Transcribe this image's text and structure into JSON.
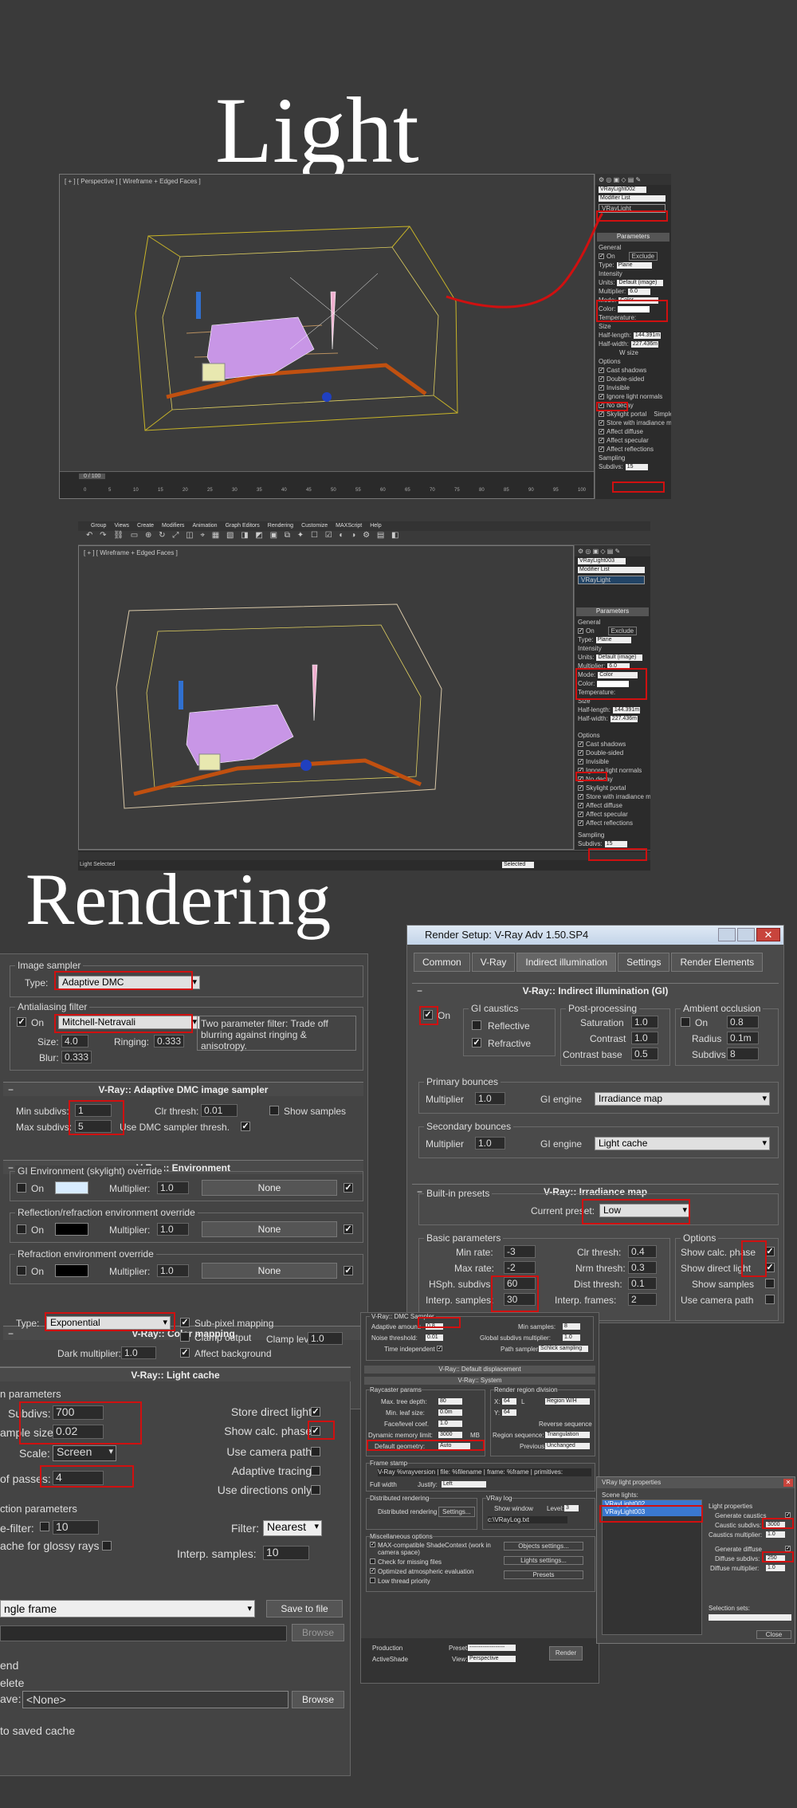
{
  "titles": {
    "light": "Light",
    "rendering": "Rendering"
  },
  "viewport1": {
    "label": "[ + ] [ Perspective ] [ Wireframe + Edged Faces ]",
    "object_name": "VRayLight002",
    "modifier_list": "Modifier List",
    "stack_item": "VRayLight",
    "timeline": "0 / 100",
    "ticks": [
      "0",
      "5",
      "10",
      "15",
      "20",
      "25",
      "30",
      "35",
      "40",
      "45",
      "50",
      "55",
      "60",
      "65",
      "70",
      "75",
      "80",
      "85",
      "90",
      "95",
      "100"
    ],
    "params": {
      "header": "Parameters",
      "general": "General",
      "on": "On",
      "exclude": "Exclude",
      "type_label": "Type:",
      "type_value": "Plane",
      "intensity": "Intensity",
      "units_label": "Units:",
      "units_value": "Default (image)",
      "multiplier_label": "Multiplier:",
      "multiplier_value": "6.0",
      "mode_label": "Mode:",
      "mode_value": "Color",
      "color_label": "Color:",
      "temp_label": "Temperature:",
      "size": "Size",
      "half_length_label": "Half-length:",
      "half_length_value": "144.391m",
      "half_width_label": "Half-width:",
      "half_width_value": "227.436m",
      "wsize_label": "W size",
      "options": "Options",
      "opt_list": [
        "Cast shadows",
        "Double-sided",
        "Invisible",
        "Ignore light normals",
        "No decay",
        "Skylight portal",
        "Store with irradiance map",
        "Affect diffuse",
        "Affect specular",
        "Affect reflections"
      ],
      "simple": "Simple",
      "sampling": "Sampling",
      "subdivs_label": "Subdivs:",
      "subdivs_value": "15"
    }
  },
  "viewport2": {
    "menu": [
      "Group",
      "Views",
      "Create",
      "Modifiers",
      "Animation",
      "Graph Editors",
      "Rendering",
      "Customize",
      "MAXScript",
      "Help"
    ],
    "label": "[ + ] [ Wireframe + Edged Faces ]",
    "object_name": "VRayLight003",
    "modifier_list": "Modifier List",
    "stack_item": "VRayLight",
    "status_left": "Light Selected",
    "selected_field": "Selected",
    "params": {
      "header": "Parameters",
      "general": "General",
      "on": "On",
      "exclude": "Exclude",
      "type_label": "Type:",
      "type_value": "Plane",
      "intensity": "Intensity",
      "units_label": "Units:",
      "units_value": "Default (image)",
      "multiplier_label": "Multiplier:",
      "multiplier_value": "6.0",
      "mode_label": "Mode:",
      "mode_value": "Color",
      "color_label": "Color:",
      "temp_label": "Temperature:",
      "size": "Size",
      "half_length_label": "Half-length:",
      "half_length_value": "144.391m",
      "half_width_label": "Half-width:",
      "half_width_value": "227.436m",
      "options": "Options",
      "opt_list": [
        "Cast shadows",
        "Double-sided",
        "Invisible",
        "Ignore light normals",
        "No decay",
        "Skylight portal",
        "Store with irradiance map",
        "Affect diffuse",
        "Affect specular",
        "Affect reflections"
      ],
      "sampling": "Sampling",
      "subdivs_label": "Subdivs:",
      "subdivs_value": "15"
    }
  },
  "left_panel": {
    "image_sampler": {
      "group": "Image sampler",
      "type_label": "Type:",
      "type_value": "Adaptive DMC"
    },
    "aa_filter": {
      "group": "Antialiasing filter",
      "on_label": "On",
      "filter_value": "Mitchell-Netravali",
      "desc": "Two parameter filter: Trade off blurring against ringing & anisotropy.",
      "size_label": "Size:",
      "size_value": "4.0",
      "ringing_label": "Ringing:",
      "ringing_value": "0.333",
      "blur_label": "Blur:",
      "blur_value": "0.333"
    },
    "adaptive_dmc": {
      "title": "V-Ray:: Adaptive DMC image sampler",
      "min_label": "Min subdivs:",
      "min_value": "1",
      "max_label": "Max subdivs:",
      "max_value": "5",
      "clr_label": "Clr thresh:",
      "clr_value": "0.01",
      "show_samples": "Show samples",
      "use_dmc": "Use DMC sampler thresh."
    },
    "environment": {
      "title": "V-Ray:: Environment",
      "gi_group": "GI Environment (skylight) override",
      "refl_group": "Reflection/refraction environment override",
      "refr_group": "Refraction environment override",
      "on": "On",
      "mult_label": "Multiplier:",
      "mult_value": "1.0",
      "none": "None"
    },
    "color_mapping": {
      "title": "V-Ray:: Color mapping",
      "type_label": "Type:",
      "type_value": "Exponential",
      "subpixel": "Sub-pixel mapping",
      "clamp": "Clamp output",
      "clamp_level_label": "Clamp level:",
      "clamp_level_value": "1.0",
      "dark_label": "Dark multiplier:",
      "dark_value": "1.0",
      "affect_bg": "Affect background"
    }
  },
  "light_cache": {
    "title": "V-Ray:: Light cache",
    "calc_params": "n parameters",
    "subdivs_label": "Subdivs:",
    "subdivs_value": "700",
    "sample_size_label": "ample size:",
    "sample_size_value": "0.02",
    "scale_label": "Scale:",
    "scale_value": "Screen",
    "passes_label": "of passes:",
    "passes_value": "4",
    "store_direct": "Store direct light",
    "show_calc": "Show calc. phase",
    "use_camera": "Use camera path",
    "adaptive": "Adaptive tracing",
    "directions": "Use directions only",
    "recon_params": "ction parameters",
    "prefilter_label": "e-filter:",
    "prefilter_value": "10",
    "glossy": "ache for glossy rays",
    "filter_label": "Filter:",
    "filter_value": "Nearest",
    "interp_label": "Interp. samples:",
    "interp_value": "10",
    "mode_value": "ngle frame",
    "save_btn": "Save to file",
    "browse1": "Browse",
    "on_end": "end",
    "delete": "elete",
    "save_label": "ave:",
    "save_value": "<None>",
    "browse2": "Browse",
    "saved_cache": "to saved cache"
  },
  "render_setup": {
    "title": "Render Setup: V-Ray Adv 1.50.SP4",
    "tabs": [
      "Common",
      "V-Ray",
      "Indirect illumination",
      "Settings",
      "Render Elements"
    ],
    "gi_title": "V-Ray:: Indirect illumination (GI)",
    "on": "On",
    "gi_caustics": "GI caustics",
    "reflective": "Reflective",
    "refractive": "Refractive",
    "post": "Post-processing",
    "saturation_label": "Saturation",
    "saturation_value": "1.0",
    "contrast_label": "Contrast",
    "contrast_value": "1.0",
    "contrast_base_label": "Contrast base",
    "contrast_base_value": "0.5",
    "ao": "Ambient occlusion",
    "ao_on": "On",
    "ao_on_value": "0.8",
    "radius_label": "Radius",
    "radius_value": "0.1m",
    "ao_subdivs_label": "Subdivs",
    "ao_subdivs_value": "8",
    "primary": "Primary bounces",
    "multiplier_label": "Multiplier",
    "primary_mult": "1.0",
    "gi_engine_label": "GI engine",
    "primary_engine": "Irradiance map",
    "secondary": "Secondary bounces",
    "secondary_mult": "1.0",
    "secondary_engine": "Light cache",
    "irr_title": "V-Ray:: Irradiance map",
    "presets": "Built-in presets",
    "current_preset_label": "Current preset:",
    "current_preset_value": "Low",
    "basic": "Basic parameters",
    "min_rate_label": "Min rate:",
    "min_rate_value": "-3",
    "max_rate_label": "Max rate:",
    "max_rate_value": "-2",
    "hsph_label": "HSph. subdivs:",
    "hsph_value": "60",
    "interp_label": "Interp. samples:",
    "interp_value": "30",
    "clr_label": "Clr thresh:",
    "clr_value": "0.4",
    "nrm_label": "Nrm thresh:",
    "nrm_value": "0.3",
    "dist_label": "Dist thresh:",
    "dist_value": "0.1",
    "frames_label": "Interp. frames:",
    "frames_value": "2",
    "options": "Options",
    "show_calc": "Show calc. phase",
    "show_direct": "Show direct light",
    "show_samples": "Show samples",
    "use_camera": "Use camera path"
  },
  "settings_panel": {
    "dmc": "V-Ray:: DMC Sampler",
    "adaptive_label": "Adaptive amount:",
    "adaptive_value": "0.8",
    "noise_label": "Noise threshold:",
    "noise_value": "0.01",
    "time_label": "Time independent",
    "min_samples_label": "Min samples:",
    "min_samples_value": "8",
    "global_label": "Global subdivs multiplier:",
    "global_value": "1.0",
    "path_label": "Path sampler:",
    "path_value": "Schlick sampling",
    "displacement": "V-Ray:: Default displacement",
    "system": "V-Ray:: System",
    "raycaster": "Raycaster params",
    "max_tree_label": "Max. tree depth:",
    "max_tree_value": "80",
    "min_leaf_label": "Min. leaf size:",
    "min_leaf_value": "0.0m",
    "face_label": "Face/level coef.",
    "face_value": "1.0",
    "dyn_mem_label": "Dynamic memory limit:",
    "dyn_mem_value": "3000",
    "mb": "MB",
    "geom_label": "Default geometry:",
    "geom_value": "Auto",
    "region": "Render region division",
    "x_label": "X:",
    "x_value": "64",
    "l_label": "L",
    "region_value": "Region W/H",
    "y_label": "Y:",
    "y_value": "64",
    "reverse": "Reverse sequence",
    "seq_label": "Region sequence:",
    "seq_value": "Triangulation",
    "prev_label": "Previous:",
    "prev_value": "Unchanged",
    "frame_stamp": "Frame stamp",
    "stamp_text": "V-Ray %vrayversion | file: %filename | frame: %frame | primitives:",
    "full_width": "Full width",
    "justify_label": "Justify:",
    "justify_value": "Left",
    "distributed": "Distributed rendering",
    "dist_render": "Distributed rendering",
    "dist_settings": "Settings...",
    "vray_log": "VRay log",
    "show_window": "Show window",
    "level_label": "Level:",
    "level_value": "3",
    "log_path": "c:\\VRayLog.txt",
    "misc": "Miscellaneous options",
    "misc_items": [
      "MAX-compatible ShadeContext (work in camera space)",
      "Check for missing files",
      "Optimized atmospheric evaluation",
      "Low thread priority"
    ],
    "objects_btn": "Objects settings...",
    "lights_btn": "Lights settings...",
    "presets_btn": "Presets",
    "production": "Production",
    "activeshade": "ActiveShade",
    "preset_label": "Preset:",
    "preset_value": "-------------------",
    "view_label": "View:",
    "view_value": "Perspective",
    "render_btn": "Render"
  },
  "light_props": {
    "title": "VRay light properties",
    "scene_lights": "Scene lights:",
    "lights": [
      "VRayLight002",
      "VRayLight003"
    ],
    "light_props": "Light properties",
    "gen_caustics": "Generate caustics",
    "caustic_subdivs_label": "Caustic subdivs:",
    "caustic_subdivs_value": "3000",
    "caustics_mult_label": "Caustics multiplier:",
    "caustics_mult_value": "1.0",
    "gen_diffuse": "Generate diffuse",
    "diffuse_subdivs_label": "Diffuse subdivs:",
    "diffuse_subdivs_value": "250",
    "diffuse_mult_label": "Diffuse multiplier:",
    "diffuse_mult_value": "1.0",
    "sel_sets": "Selection sets:",
    "close": "Close"
  }
}
